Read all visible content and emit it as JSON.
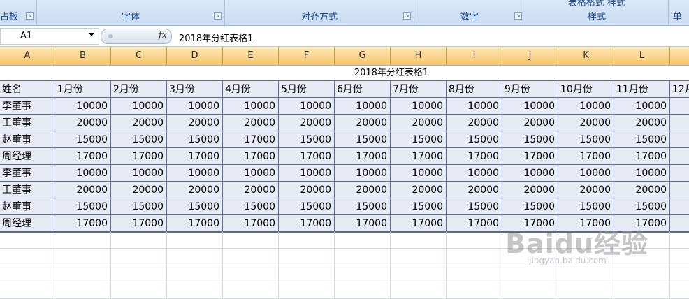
{
  "ribbon": {
    "groups": [
      {
        "label": "占板"
      },
      {
        "label": "字体"
      },
      {
        "label": "对齐方式"
      },
      {
        "label": "数字"
      },
      {
        "label": "样式"
      },
      {
        "label": "单"
      }
    ],
    "partial_top_label": "表格格式  样式"
  },
  "formula_bar": {
    "name_box": "A1",
    "fx": "fx",
    "content": "2018年分红表格1"
  },
  "columns": [
    "A",
    "B",
    "C",
    "D",
    "E",
    "F",
    "G",
    "H",
    "I",
    "J",
    "K",
    "L"
  ],
  "sheet": {
    "title": "2018年分红表格1",
    "header": [
      "姓名",
      "1月份",
      "2月份",
      "3月份",
      "4月份",
      "5月份",
      "6月份",
      "7月份",
      "8月份",
      "9月份",
      "10月份",
      "11月份",
      "12月"
    ],
    "rows": [
      {
        "name": "李董事",
        "values": [
          "10000",
          "10000",
          "10000",
          "10000",
          "10000",
          "10000",
          "10000",
          "10000",
          "10000",
          "10000",
          "10000"
        ]
      },
      {
        "name": "王董事",
        "values": [
          "20000",
          "20000",
          "20000",
          "20000",
          "20000",
          "20000",
          "20000",
          "20000",
          "20000",
          "20000",
          "20000"
        ]
      },
      {
        "name": "赵董事",
        "values": [
          "15000",
          "15000",
          "15000",
          "17000",
          "15000",
          "15000",
          "15000",
          "15000",
          "15000",
          "15000",
          "15000"
        ]
      },
      {
        "name": "周经理",
        "values": [
          "17000",
          "17000",
          "17000",
          "17000",
          "17000",
          "17000",
          "17000",
          "17000",
          "17000",
          "17000",
          "17000"
        ]
      },
      {
        "name": "李董事",
        "values": [
          "10000",
          "10000",
          "10000",
          "10000",
          "10000",
          "10000",
          "10000",
          "10000",
          "10000",
          "10000",
          "10000"
        ]
      },
      {
        "name": "王董事",
        "values": [
          "20000",
          "20000",
          "20000",
          "20000",
          "20000",
          "20000",
          "20000",
          "20000",
          "20000",
          "20000",
          "20000"
        ]
      },
      {
        "name": "赵董事",
        "values": [
          "15000",
          "15000",
          "15000",
          "15000",
          "15000",
          "15000",
          "15000",
          "15000",
          "15000",
          "15000",
          "15000"
        ]
      },
      {
        "name": "周经理",
        "values": [
          "17000",
          "17000",
          "17000",
          "17000",
          "17000",
          "17000",
          "17000",
          "17000",
          "17000",
          "17000",
          "17000"
        ]
      }
    ]
  },
  "watermark": {
    "brand": "Baidu经验",
    "url": "jingyan.baidu.com"
  }
}
